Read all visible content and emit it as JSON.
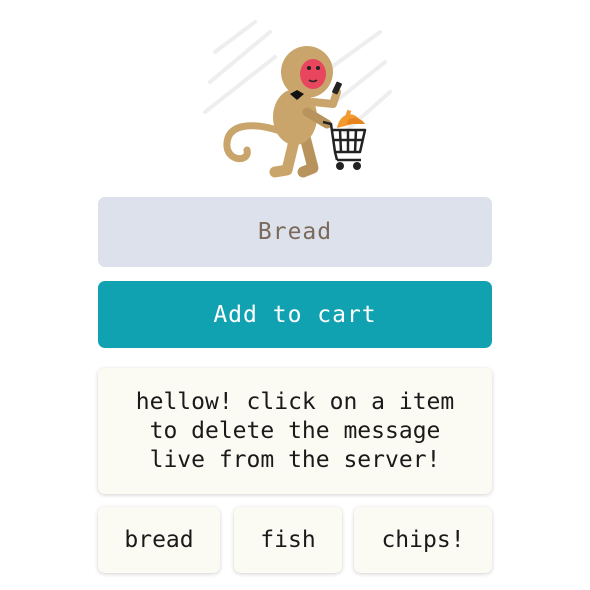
{
  "input": {
    "value": "Bread"
  },
  "add_button": {
    "label": "Add to cart"
  },
  "message": {
    "line1": "hellow! click on a item",
    "line2": "to delete the message",
    "line3": "live from the server!"
  },
  "items": [
    {
      "label": "bread"
    },
    {
      "label": "fish"
    },
    {
      "label": "chips!"
    }
  ],
  "colors": {
    "input_bg": "#dde1ec",
    "button_bg": "#11a2b2",
    "card_bg": "#fcfbf3"
  },
  "icons": {
    "mascot": "monkey-shopping-cart-illustration"
  }
}
